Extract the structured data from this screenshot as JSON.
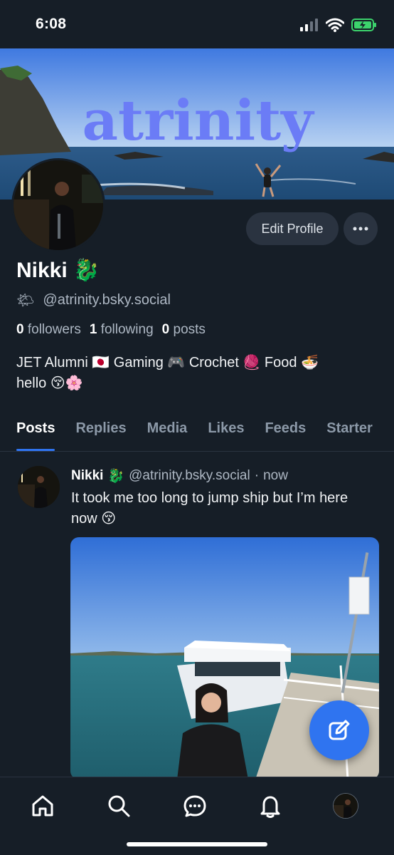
{
  "status_bar": {
    "time": "6:08"
  },
  "banner": {
    "wordmark": "atrinity",
    "accent_color": "#6b7cf6"
  },
  "profile": {
    "edit_label": "Edit Profile",
    "display_name": "Nikki",
    "name_emoji": "🐉",
    "handle_emoji": "🌤",
    "handle": "@atrinity.bsky.social",
    "followers_count": "0",
    "followers_label": "followers",
    "following_count": "1",
    "following_label": "following",
    "posts_count": "0",
    "posts_label": "posts",
    "bio_line1": "JET Alumni 🇯🇵 Gaming 🎮 Crochet 🧶 Food 🍜",
    "bio_line2": "hello 😚🌸"
  },
  "tabs": [
    {
      "label": "Posts",
      "active": true
    },
    {
      "label": "Replies",
      "active": false
    },
    {
      "label": "Media",
      "active": false
    },
    {
      "label": "Likes",
      "active": false
    },
    {
      "label": "Feeds",
      "active": false
    },
    {
      "label": "Starter",
      "active": false
    }
  ],
  "post": {
    "author": "Nikki",
    "author_emoji": "🐉",
    "handle": "@atrinity.bsky.social",
    "separator": "·",
    "time": "now",
    "text": "It took me too long to jump ship but I’m here now 😚"
  },
  "bottom_nav": {
    "items": [
      "home-icon",
      "search-icon",
      "chat-icon",
      "bell-icon",
      "profile-avatar"
    ]
  },
  "colors": {
    "background": "#161e27",
    "accent": "#2f74f0",
    "muted": "#aeb8c4"
  }
}
